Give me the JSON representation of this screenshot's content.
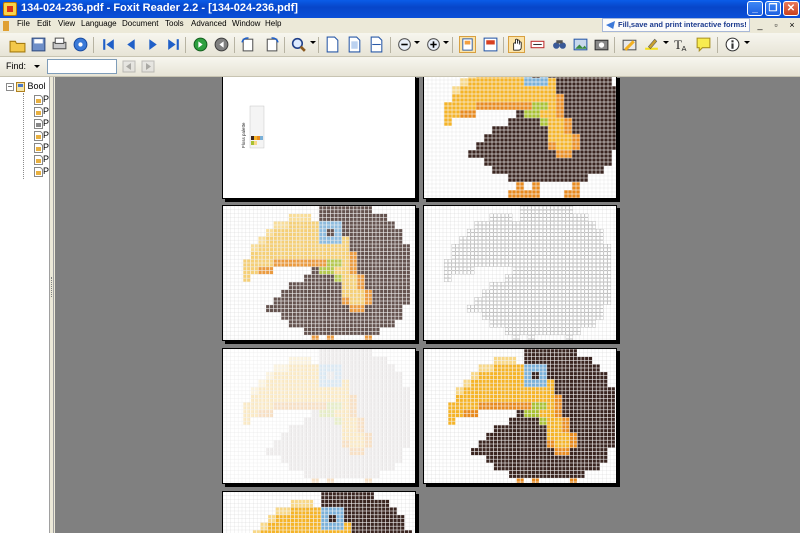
{
  "window": {
    "title": "134-024-236.pdf - Foxit Reader 2.2 - [134-024-236.pdf]",
    "minimize": "_",
    "restore": "❐",
    "close": "✕"
  },
  "menu": {
    "items": [
      "File",
      "Edit",
      "View",
      "Language",
      "Document",
      "Tools",
      "Advanced",
      "Window",
      "Help"
    ],
    "promo": "Fill,save and print interactive forms!"
  },
  "findbar": {
    "label": "Find:",
    "value": ""
  },
  "bookmarks": {
    "root_label": "Bool",
    "items": [
      "P",
      "P",
      "P",
      "P",
      "P",
      "P",
      "P"
    ]
  },
  "page1": {
    "palette_title": "Floss palette"
  },
  "colors": {
    "toucan_black": "#3a2520",
    "toucan_yellow": "#f5b428",
    "toucan_orange": "#e88a1e",
    "toucan_light": "#f8d888",
    "toucan_blue": "#7ab0d8",
    "toucan_green": "#a8c030",
    "window_blue": "#0a5ce8"
  }
}
